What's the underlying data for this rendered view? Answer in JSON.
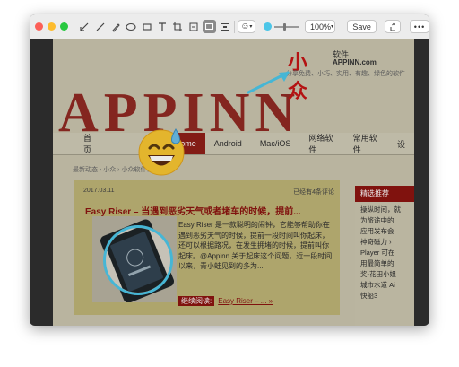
{
  "toolbar": {
    "zoom": "100%",
    "save_label": "Save"
  },
  "site": {
    "logo_text": "小众",
    "logo_soft": "软件",
    "logo_domain": "APPINN.com",
    "slogan": "分享免费、小巧、实用、有趣、绿色的软件",
    "header_letters": "APPINN",
    "nav": [
      "首页",
      "Chrome",
      "Android",
      "Mac/iOS",
      "网络软件",
      "常用软件",
      "设"
    ],
    "breadcrumb": "最新动态 › 小众 › 小众软件公众号",
    "sidebar_title": "精选推荐",
    "sidebar_items": [
      "操纵时间，就",
      "为旅途中的",
      "应用发布会",
      "神奇磁力 ›",
      "Player 可在",
      "用最简单的",
      "奖-花田小姐",
      "城市水道 Ai",
      "快船3"
    ]
  },
  "article": {
    "date": "2017.03.11",
    "comments": "已经有4条评论",
    "title": "Easy Riser – 当遇到恶劣天气或者堵车的时候，提前...",
    "excerpt": "Easy Riser 是一款聪明的闹钟，它能够帮助你在遇到恶劣天气的时候，提前一段时间叫你起床，还可以根据路况，在发生拥堵的时候，提前叫你起床。@Appinn 关于起床这个问题，近一段时间以来，青小蛙见到的多为...",
    "read_more_label": "继续阅读:",
    "read_more_link": "Easy Riser – ... »"
  },
  "colors": {
    "accent": "#4cc6e8",
    "brand_red": "#8b1410",
    "mark_overlay": "#bdb376"
  }
}
